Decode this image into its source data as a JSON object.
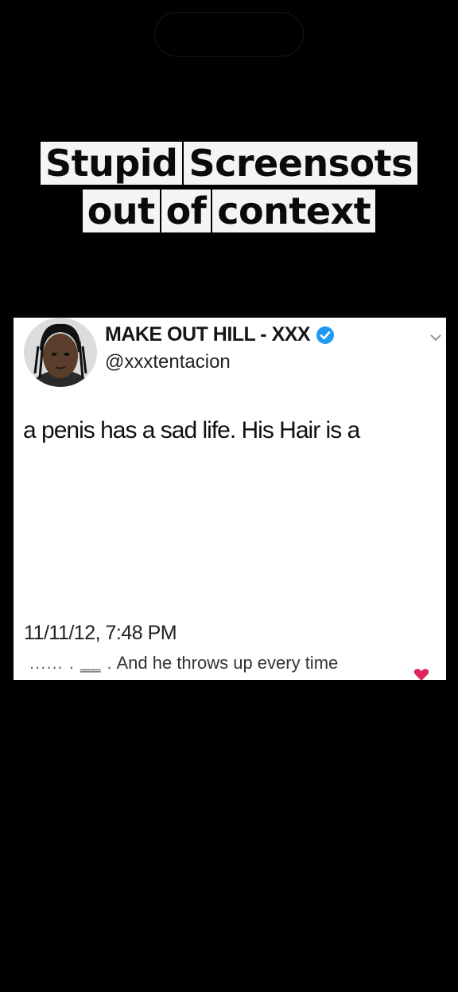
{
  "caption": {
    "line1": [
      "Stupid",
      "Screensots"
    ],
    "line2": [
      "out",
      "of",
      "context"
    ]
  },
  "tweet": {
    "display_name": "MAKE OUT HILL - XXX",
    "handle": "@xxxtentacion",
    "text": "a penis has a sad life. His Hair is a",
    "timestamp": "11/11/12, 7:48 PM",
    "verified_icon": "verified-badge-icon",
    "menu_icon": "chevron-down-icon"
  },
  "subtitle": {
    "faded_prefix": "......  . ‗‗ .",
    "text": "And he throws up every time"
  },
  "colors": {
    "background": "#000000",
    "card": "#ffffff",
    "verified": "#1d9bf0",
    "heart": "#e0245e"
  }
}
